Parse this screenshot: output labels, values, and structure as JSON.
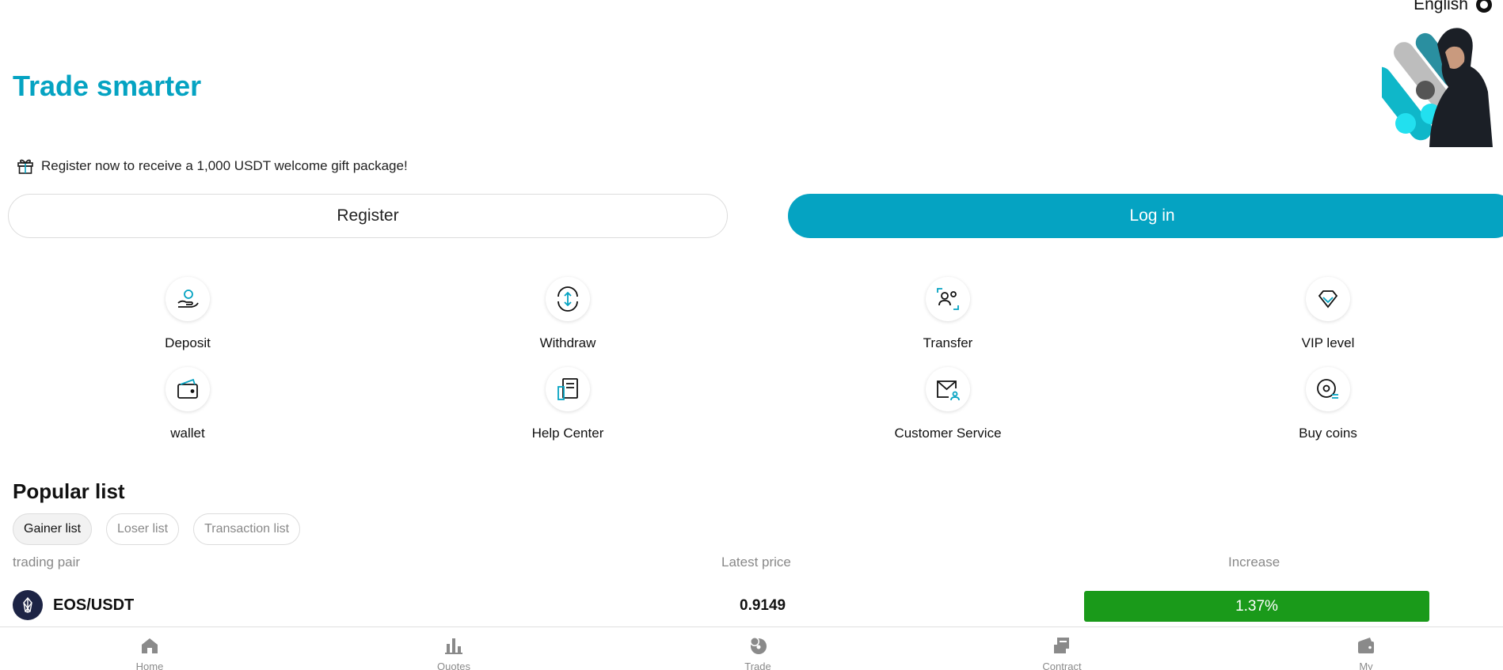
{
  "header": {
    "language": "English",
    "headline": "Trade smarter"
  },
  "promo": {
    "text": "Register now to receive a 1,000 USDT welcome gift package!"
  },
  "auth": {
    "register_label": "Register",
    "login_label": "Log in"
  },
  "quick_actions": [
    {
      "label": "Deposit",
      "icon": "deposit-icon"
    },
    {
      "label": "Withdraw",
      "icon": "withdraw-icon"
    },
    {
      "label": "Transfer",
      "icon": "transfer-icon"
    },
    {
      "label": "VIP level",
      "icon": "diamond-icon"
    },
    {
      "label": "wallet",
      "icon": "wallet-icon"
    },
    {
      "label": "Help Center",
      "icon": "help-center-icon"
    },
    {
      "label": "Customer Service",
      "icon": "customer-service-icon"
    },
    {
      "label": "Buy coins",
      "icon": "buy-coins-icon"
    }
  ],
  "popular": {
    "title": "Popular list",
    "tabs": [
      {
        "label": "Gainer list",
        "active": true
      },
      {
        "label": "Loser list",
        "active": false
      },
      {
        "label": "Transaction list",
        "active": false
      }
    ],
    "columns": {
      "pair": "trading pair",
      "price": "Latest price",
      "change": "Increase"
    },
    "rows": [
      {
        "pair": "EOS/USDT",
        "price": "0.9149",
        "change": "1.37%"
      }
    ]
  },
  "bottom_nav": [
    {
      "label": "Home",
      "icon": "home-icon"
    },
    {
      "label": "Quotes",
      "icon": "bar-chart-icon"
    },
    {
      "label": "Trade",
      "icon": "trade-icon"
    },
    {
      "label": "Contract",
      "icon": "contract-icon"
    },
    {
      "label": "My",
      "icon": "profile-wallet-icon"
    }
  ],
  "colors": {
    "accent": "#05a3c2",
    "gain": "#1a9a1a"
  }
}
